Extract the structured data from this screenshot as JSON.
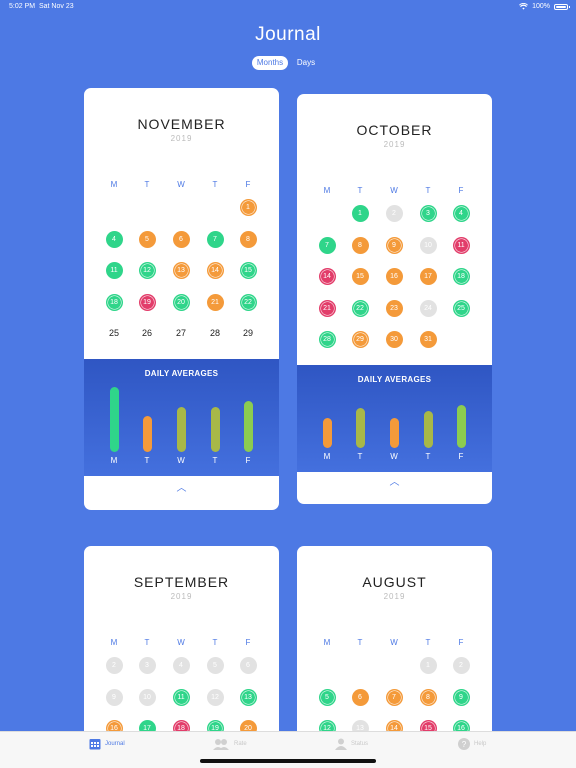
{
  "status": {
    "time": "5:02 PM",
    "date": "Sat Nov 23",
    "battery": "100%"
  },
  "title": "Journal",
  "segments": [
    {
      "label": "Months",
      "active": true
    },
    {
      "label": "Days",
      "active": false
    }
  ],
  "cards": {
    "november": {
      "month": "NOVEMBER",
      "year": "2019",
      "weekdays": [
        "M",
        "T",
        "W",
        "T",
        "F"
      ],
      "days": [
        {
          "n": "1",
          "c": "orange",
          "ring": true
        },
        {
          "n": "4",
          "c": "green"
        },
        {
          "n": "5",
          "c": "orange"
        },
        {
          "n": "6",
          "c": "orange"
        },
        {
          "n": "7",
          "c": "green"
        },
        {
          "n": "8",
          "c": "orange"
        },
        {
          "n": "11",
          "c": "green"
        },
        {
          "n": "12",
          "c": "green",
          "ring": true
        },
        {
          "n": "13",
          "c": "orange",
          "ring": true
        },
        {
          "n": "14",
          "c": "orange",
          "ring": true
        },
        {
          "n": "15",
          "c": "green",
          "ring": true
        },
        {
          "n": "18",
          "c": "green",
          "ring": true
        },
        {
          "n": "19",
          "c": "red",
          "ring": true
        },
        {
          "n": "20",
          "c": "green",
          "ring": true
        },
        {
          "n": "21",
          "c": "orange"
        },
        {
          "n": "22",
          "c": "green",
          "ring": true
        },
        {
          "n": "25",
          "c": "plain"
        },
        {
          "n": "26",
          "c": "plain"
        },
        {
          "n": "27",
          "c": "plain"
        },
        {
          "n": "28",
          "c": "plain"
        },
        {
          "n": "29",
          "c": "plain"
        }
      ],
      "averages_title": "DAILY AVERAGES",
      "averages": [
        {
          "day": "M",
          "level": 1.0,
          "color": "#2fd58a"
        },
        {
          "day": "T",
          "level": 0.55,
          "color": "#f49a3a"
        },
        {
          "day": "W",
          "level": 0.7,
          "color": "#a8b848"
        },
        {
          "day": "T",
          "level": 0.7,
          "color": "#a8b848"
        },
        {
          "day": "F",
          "level": 0.78,
          "color": "#8ccc50"
        }
      ]
    },
    "october": {
      "month": "OCTOBER",
      "year": "2019",
      "weekdays": [
        "M",
        "T",
        "W",
        "T",
        "F"
      ],
      "days": [
        {
          "n": "1",
          "c": "green"
        },
        {
          "n": "2",
          "c": "grey"
        },
        {
          "n": "3",
          "c": "green",
          "ring": true
        },
        {
          "n": "4",
          "c": "green",
          "ring": true
        },
        {
          "n": "7",
          "c": "green"
        },
        {
          "n": "8",
          "c": "orange"
        },
        {
          "n": "9",
          "c": "orange",
          "ring": true
        },
        {
          "n": "10",
          "c": "grey"
        },
        {
          "n": "11",
          "c": "red",
          "ring": true
        },
        {
          "n": "14",
          "c": "red",
          "ring": true
        },
        {
          "n": "15",
          "c": "orange"
        },
        {
          "n": "16",
          "c": "orange"
        },
        {
          "n": "17",
          "c": "orange"
        },
        {
          "n": "18",
          "c": "green",
          "ring": true
        },
        {
          "n": "21",
          "c": "red",
          "ring": true
        },
        {
          "n": "22",
          "c": "green",
          "ring": true
        },
        {
          "n": "23",
          "c": "orange"
        },
        {
          "n": "24",
          "c": "grey"
        },
        {
          "n": "25",
          "c": "green",
          "ring": true
        },
        {
          "n": "28",
          "c": "green",
          "ring": true
        },
        {
          "n": "29",
          "c": "orange",
          "ring": true
        },
        {
          "n": "30",
          "c": "orange"
        },
        {
          "n": "31",
          "c": "orange"
        }
      ],
      "averages_title": "DAILY AVERAGES",
      "averages": [
        {
          "day": "M",
          "level": 0.55,
          "color": "#f49a3a"
        },
        {
          "day": "T",
          "level": 0.72,
          "color": "#a8b848"
        },
        {
          "day": "W",
          "level": 0.55,
          "color": "#f49a3a"
        },
        {
          "day": "T",
          "level": 0.68,
          "color": "#a8b848"
        },
        {
          "day": "F",
          "level": 0.78,
          "color": "#8ccc50"
        }
      ]
    },
    "september": {
      "month": "SEPTEMBER",
      "year": "2019",
      "weekdays": [
        "M",
        "T",
        "W",
        "T",
        "F"
      ],
      "days": [
        {
          "n": "2",
          "c": "grey"
        },
        {
          "n": "3",
          "c": "grey"
        },
        {
          "n": "4",
          "c": "grey"
        },
        {
          "n": "5",
          "c": "grey"
        },
        {
          "n": "6",
          "c": "grey"
        },
        {
          "n": "9",
          "c": "grey"
        },
        {
          "n": "10",
          "c": "grey"
        },
        {
          "n": "11",
          "c": "green",
          "ring": true
        },
        {
          "n": "12",
          "c": "grey"
        },
        {
          "n": "13",
          "c": "green",
          "ring": true
        },
        {
          "n": "16",
          "c": "orange",
          "ring": true
        },
        {
          "n": "17",
          "c": "green"
        },
        {
          "n": "18",
          "c": "red",
          "ring": true
        },
        {
          "n": "19",
          "c": "green",
          "ring": true
        },
        {
          "n": "20",
          "c": "orange"
        }
      ]
    },
    "august": {
      "month": "AUGUST",
      "year": "2019",
      "weekdays": [
        "M",
        "T",
        "W",
        "T",
        "F"
      ],
      "days": [
        {
          "n": "1",
          "c": "grey"
        },
        {
          "n": "2",
          "c": "grey"
        },
        {
          "n": "5",
          "c": "green",
          "ring": true
        },
        {
          "n": "6",
          "c": "orange"
        },
        {
          "n": "7",
          "c": "orange",
          "ring": true
        },
        {
          "n": "8",
          "c": "orange",
          "ring": true
        },
        {
          "n": "9",
          "c": "green",
          "ring": true
        },
        {
          "n": "12",
          "c": "green",
          "ring": true
        },
        {
          "n": "13",
          "c": "grey"
        },
        {
          "n": "14",
          "c": "orange",
          "ring": true
        },
        {
          "n": "15",
          "c": "red",
          "ring": true
        },
        {
          "n": "16",
          "c": "green",
          "ring": true
        }
      ]
    }
  },
  "tabs": [
    {
      "label": "Journal",
      "icon": "calendar-icon",
      "active": true
    },
    {
      "label": "Rate",
      "icon": "people-icon",
      "active": false
    },
    {
      "label": "Status",
      "icon": "person-icon",
      "active": false
    },
    {
      "label": "Help",
      "icon": "help-icon",
      "active": false
    }
  ]
}
